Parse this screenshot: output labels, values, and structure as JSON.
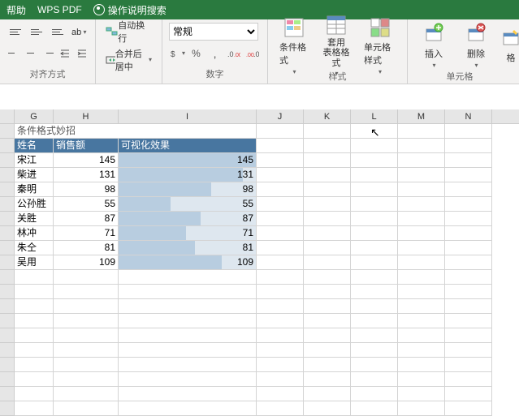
{
  "menubar": {
    "help": "帮助",
    "wps": "WPS PDF",
    "search": "操作说明搜索"
  },
  "ribbon": {
    "align": {
      "wrap": "自动换行",
      "merge": "合并后居中",
      "label": "对齐方式"
    },
    "number": {
      "format": "常规",
      "label": "数字"
    },
    "styles": {
      "cond": "条件格式",
      "table": "套用\n表格格式",
      "cell": "单元格样式",
      "label": "样式"
    },
    "cells": {
      "insert": "插入",
      "delete": "删除",
      "format": "格",
      "label": "单元格"
    }
  },
  "columns": [
    "G",
    "H",
    "I",
    "J",
    "K",
    "L",
    "M",
    "N"
  ],
  "title": "条件格式妙招",
  "headers": {
    "name": "姓名",
    "sales": "销售额",
    "viz": "可视化效果"
  },
  "chart_data": {
    "type": "bar",
    "title": "条件格式妙招",
    "xlabel": "姓名",
    "ylabel": "销售额",
    "categories": [
      "宋江",
      "柴进",
      "秦明",
      "公孙胜",
      "关胜",
      "林冲",
      "朱仝",
      "吴用"
    ],
    "values": [
      145,
      131,
      98,
      55,
      87,
      71,
      81,
      109
    ],
    "ylim": [
      0,
      145
    ]
  }
}
